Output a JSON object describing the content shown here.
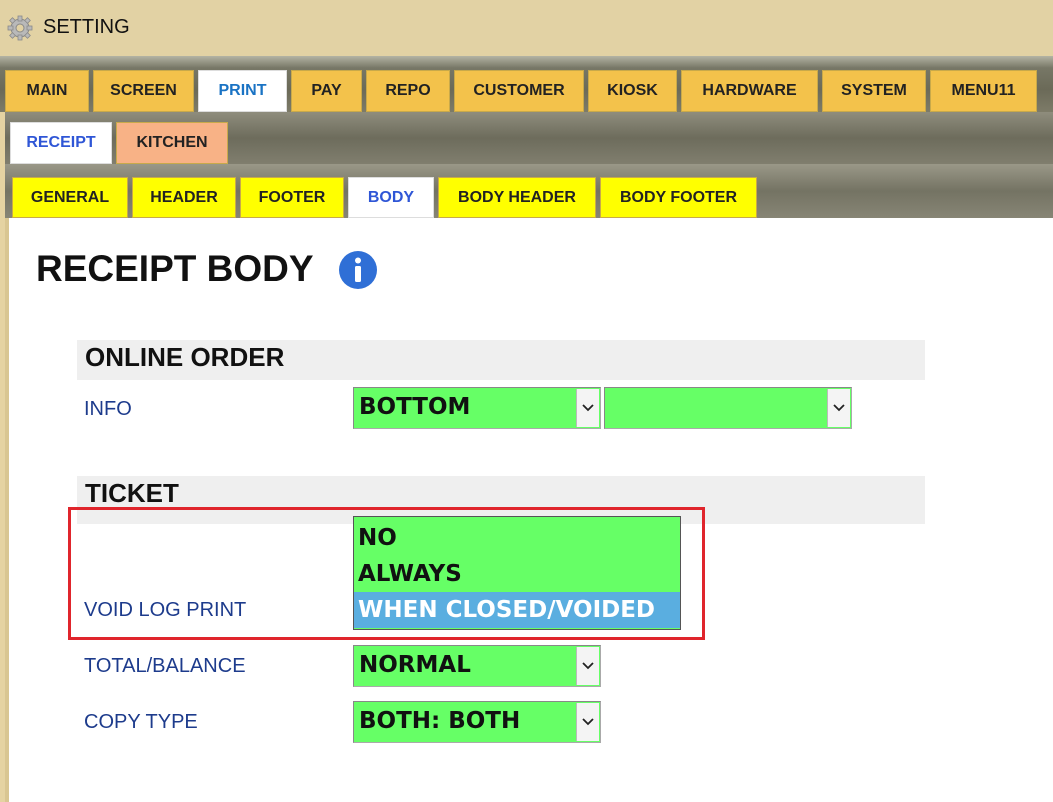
{
  "window": {
    "title": "SETTING",
    "icon": "gear-icon"
  },
  "main_tabs": [
    {
      "label": "MAIN"
    },
    {
      "label": "SCREEN"
    },
    {
      "label": "PRINT"
    },
    {
      "label": "PAY"
    },
    {
      "label": "REPO"
    },
    {
      "label": "CUSTOMER"
    },
    {
      "label": "KIOSK"
    },
    {
      "label": "HARDWARE"
    },
    {
      "label": "SYSTEM"
    },
    {
      "label": "MENU11"
    }
  ],
  "main_tab_active": "PRINT",
  "sub_tabs": [
    {
      "label": "RECEIPT"
    },
    {
      "label": "KITCHEN"
    }
  ],
  "sub_tab_active": "RECEIPT",
  "body_tabs": [
    {
      "label": "GENERAL"
    },
    {
      "label": "HEADER"
    },
    {
      "label": "FOOTER"
    },
    {
      "label": "BODY"
    },
    {
      "label": "BODY HEADER"
    },
    {
      "label": "BODY FOOTER"
    }
  ],
  "body_tab_active": "BODY",
  "page": {
    "title": "RECEIPT BODY",
    "info_icon": "info-icon"
  },
  "online_order": {
    "heading": "ONLINE ORDER",
    "info_label": "INFO",
    "info_value": "BOTTOM",
    "info_value2": ""
  },
  "ticket": {
    "heading": "TICKET",
    "void_log_label": "VOID LOG PRINT",
    "void_log_options": [
      "NO",
      "ALWAYS",
      "WHEN CLOSED/VOIDED"
    ],
    "void_log_selected": "WHEN CLOSED/VOIDED",
    "total_balance_label": "TOTAL/BALANCE",
    "total_balance_value": "NORMAL",
    "copy_type_label": "COPY TYPE",
    "copy_type_value": "BOTH: BOTH"
  },
  "colors": {
    "select_bg": "#66ff66",
    "main_tab": "#f3c24b",
    "body_tab": "#ffff00",
    "kitchen_tab": "#f8b286",
    "highlight_box": "#e0252c",
    "option_selected": "#5aaee0"
  }
}
